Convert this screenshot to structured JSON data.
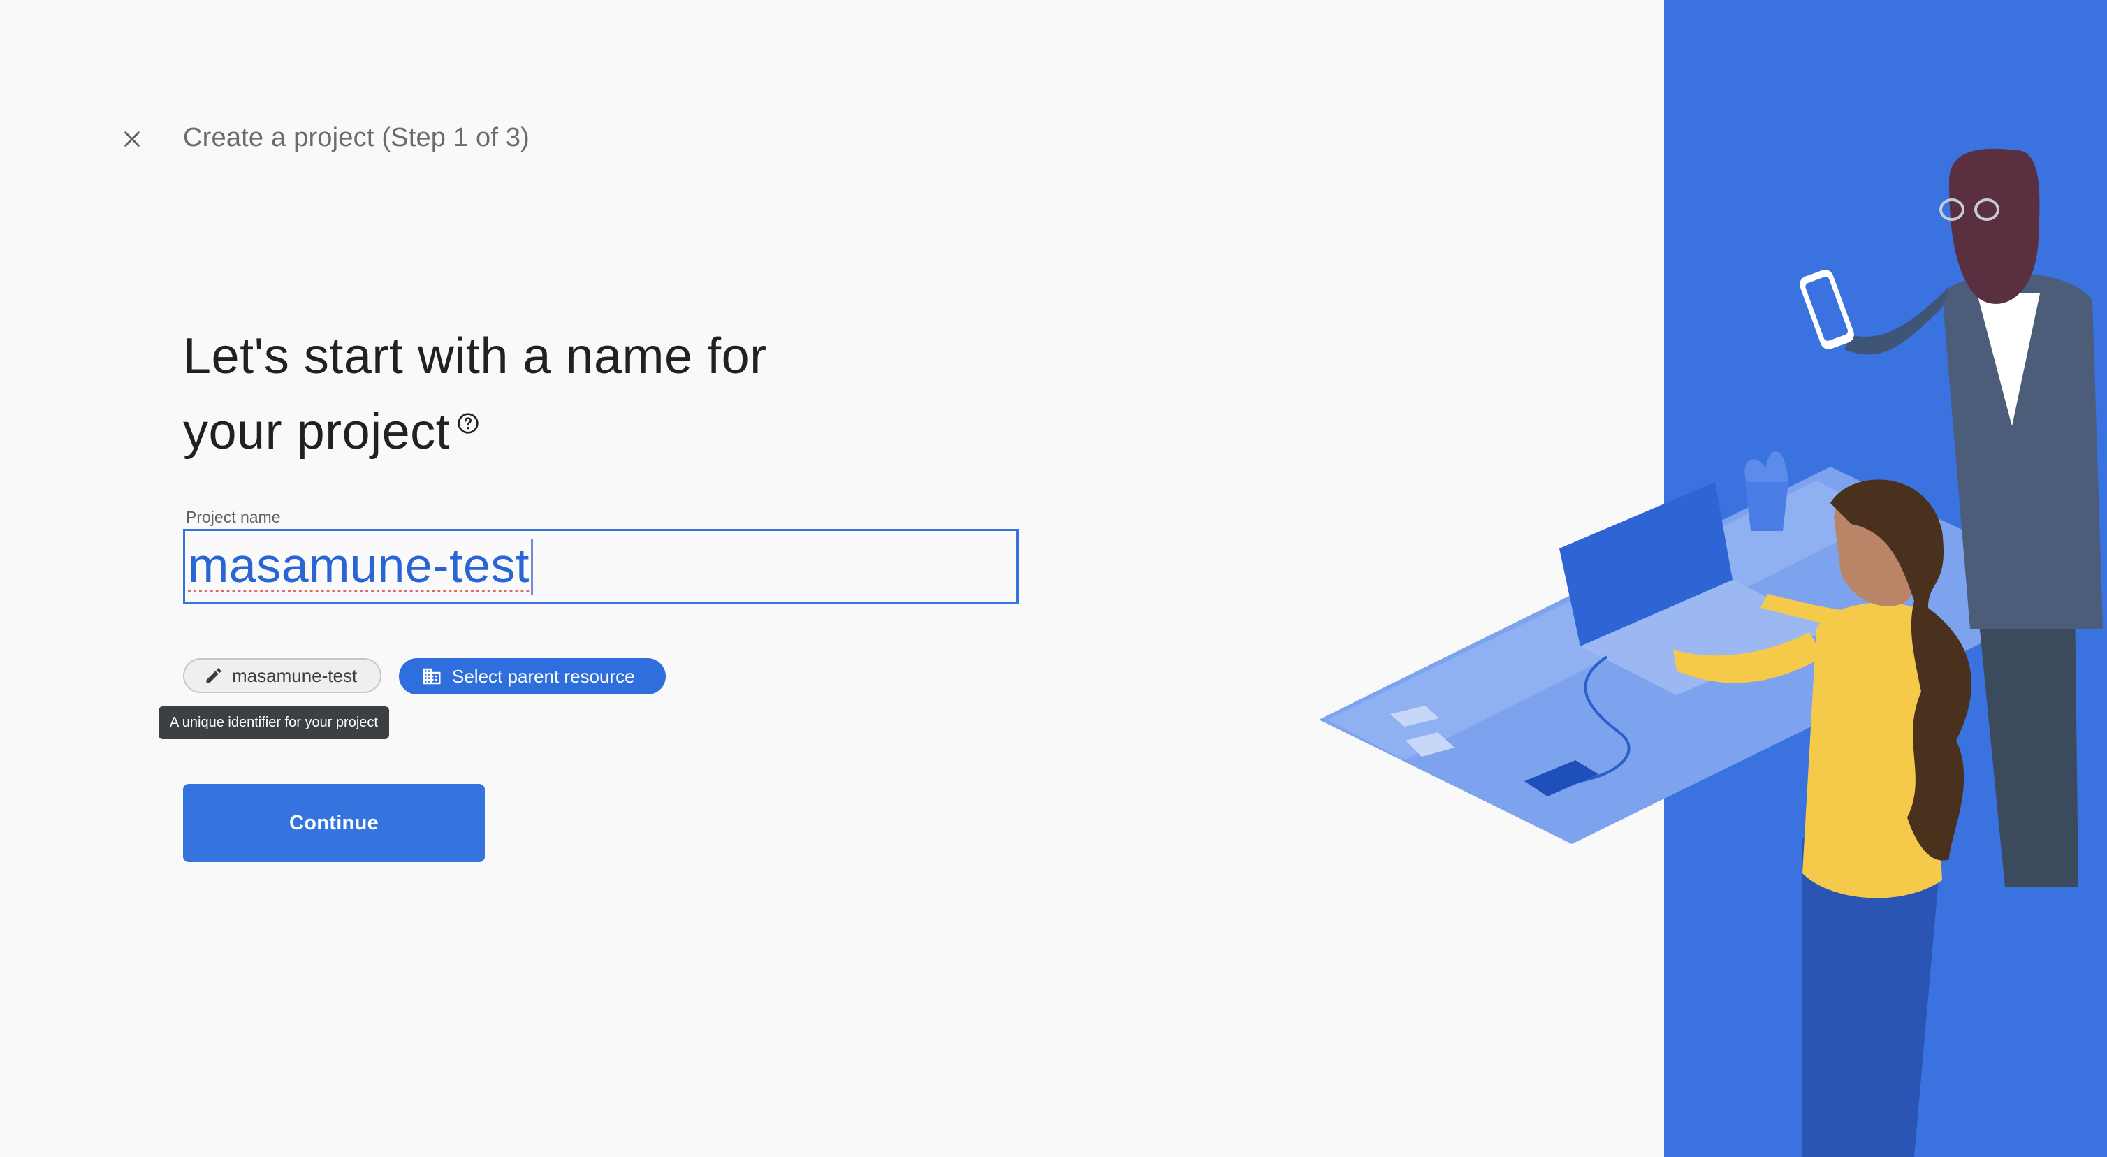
{
  "header": {
    "title": "Create a project (Step 1 of 3)",
    "close_icon": "close-icon"
  },
  "heading": {
    "line1": "Let's start with a name for",
    "line2": "your project",
    "help_icon": "help-circle-icon"
  },
  "project_name": {
    "label": "Project name",
    "value": "masamune-test"
  },
  "chips": {
    "project_id": {
      "label": "masamune-test",
      "icon": "pencil-icon"
    },
    "parent_resource": {
      "label": "Select parent resource",
      "icon": "organization-icon"
    }
  },
  "tooltip": {
    "text": "A unique identifier for your project"
  },
  "continue_button": {
    "label": "Continue"
  },
  "colors": {
    "accent": "#3573df",
    "panel_blue": "#3a72e0",
    "tooltip_bg": "#3c4043"
  }
}
